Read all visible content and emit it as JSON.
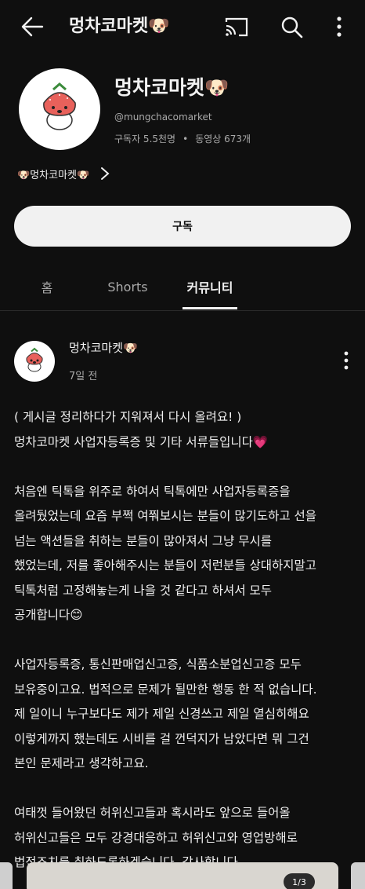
{
  "header": {
    "title": "멍차코마켓🐶"
  },
  "channel": {
    "name": "멍차코마켓🐶",
    "handle": "@mungchacomarket",
    "subscribers": "구독자 5.5천명",
    "dot": "•",
    "videos": "동영상 673개",
    "link_text": "🐶멍차코마켓🐶"
  },
  "subscribe_label": "구독",
  "tabs": [
    "홈",
    "Shorts",
    "커뮤니티"
  ],
  "post": {
    "author": "멍차코마켓🐶",
    "time": "7일 전",
    "body": "( 게시글 정리하다가 지워져서 다시 올려요! )\n멍차코마켓 사업자등록증 및 기타 서류들입니다💗\n\n처음엔 틱톡을 위주로 하여서 틱톡에만 사업자등록증을\n올려뒀었는데 요즘 부쩍 여쭤보시는 분들이 많기도하고 선을\n넘는 액션들을 취하는 분들이 많아져서 그냥 무시를\n했었는데, 저를 좋아해주시는 분들이 저런분들 상대하지말고\n틱톡처럼 고정해놓는게 나을 것 같다고 하셔서 모두\n공개합니다😊\n\n사업자등록증, 통신판매업신고증, 식품소분업신고증 모두\n보유중이고요. 법적으로 문제가 될만한 행동 한 적 없습니다.\n제 일이니 누구보다도 제가 제일 신경쓰고 제일 열심히해요\n이렇게까지 했는데도 시비를 걸 껀덕지가 남았다면 뭐 그건\n본인 문제라고 생각하고요.\n\n여태껏 들어왔던 허위신고들과 혹시라도 앞으로 들어올\n허위신고들은 모두 강경대응하고 허위신고와 영업방해로\n법적조치를 취하도록하겠습니다. 감사합니다"
  },
  "carousel": {
    "counter": "1/3"
  },
  "icons": {
    "back": "back-arrow-icon",
    "cast": "cast-icon",
    "search": "search-icon",
    "more": "more-vert-icon",
    "chevron": "chevron-right-icon"
  },
  "colors": {
    "background": "#0f0f0f",
    "text": "#f1f1f1",
    "secondary": "#aaaaaa",
    "button": "#f1f1f1"
  }
}
